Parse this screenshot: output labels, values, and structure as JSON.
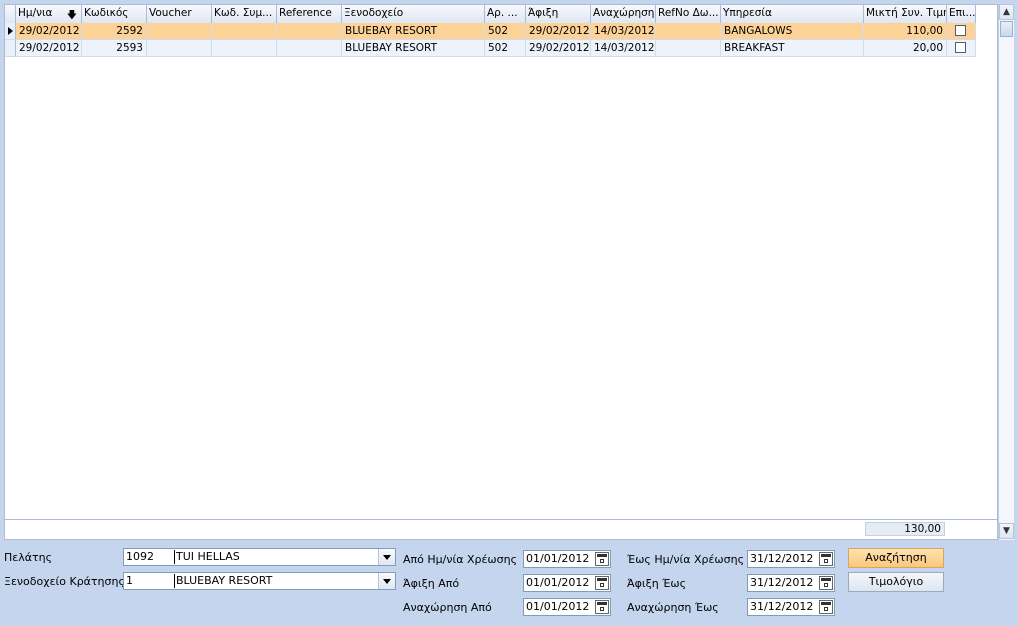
{
  "grid": {
    "columns": [
      "Ημ/νια",
      "Κωδικός",
      "Voucher",
      "Κωδ. Συμ...",
      "Reference",
      "Ξενοδοχείο",
      "Αρ. ...",
      "Άφιξη",
      "Αναχώρηση",
      "RefNo Δω...",
      "Υπηρεσία",
      "Μικτή Συν. Τιμή",
      "Επι..."
    ],
    "rows": [
      {
        "date": "29/02/2012",
        "code": "2592",
        "voucher": "",
        "contract": "",
        "reference": "",
        "hotel": "BLUEBAY RESORT",
        "room": "502",
        "arrival": "29/02/2012",
        "departure": "14/03/2012",
        "refno": "",
        "service": "BANGALOWS",
        "price": "110,00"
      },
      {
        "date": "29/02/2012",
        "code": "2593",
        "voucher": "",
        "contract": "",
        "reference": "",
        "hotel": "BLUEBAY RESORT",
        "room": "502",
        "arrival": "29/02/2012",
        "departure": "14/03/2012",
        "refno": "",
        "service": "BREAKFAST",
        "price": "20,00"
      }
    ],
    "total": "130,00"
  },
  "filters": {
    "customer_label": "Πελάτης",
    "customer_code": "1092",
    "customer_name": "TUI HELLAS",
    "hotel_label": "Ξενοδοχείο Κράτησης",
    "hotel_code": "1",
    "hotel_name": "BLUEBAY RESORT",
    "charge_from_label": "Από Ημ/νία Χρέωσης",
    "charge_from": "01/01/2012",
    "arrival_from_label": "Άφιξη Από",
    "arrival_from": "01/01/2012",
    "departure_from_label": "Αναχώρηση Από",
    "departure_from": "01/01/2012",
    "charge_to_label": "Έως Ημ/νία Χρέωσης",
    "charge_to": "31/12/2012",
    "arrival_to_label": "Άφιξη Έως",
    "arrival_to": "31/12/2012",
    "departure_to_label": "Αναχώρηση Έως",
    "departure_to": "31/12/2012"
  },
  "buttons": {
    "search": "Αναζήτηση",
    "invoice": "Τιμολόγιο"
  }
}
